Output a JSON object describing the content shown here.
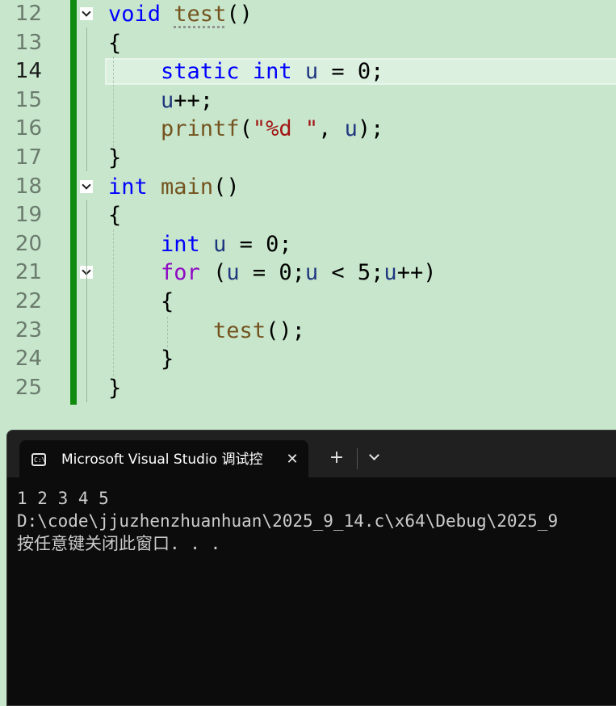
{
  "editor": {
    "lines": [
      {
        "num": "12",
        "tokens": [
          {
            "t": "void",
            "c": "kw"
          },
          {
            "t": " "
          },
          {
            "t": "test",
            "c": "fn squiggle"
          },
          {
            "t": "()"
          }
        ]
      },
      {
        "num": "13",
        "tokens": [
          {
            "t": "{"
          }
        ]
      },
      {
        "num": "14",
        "tokens": [
          {
            "t": "    "
          },
          {
            "t": "static",
            "c": "kw"
          },
          {
            "t": " "
          },
          {
            "t": "int",
            "c": "kw"
          },
          {
            "t": " "
          },
          {
            "t": "u",
            "c": "var"
          },
          {
            "t": " = 0;"
          }
        ]
      },
      {
        "num": "15",
        "tokens": [
          {
            "t": "    "
          },
          {
            "t": "u",
            "c": "var"
          },
          {
            "t": "++;"
          }
        ]
      },
      {
        "num": "16",
        "tokens": [
          {
            "t": "    "
          },
          {
            "t": "printf",
            "c": "fn"
          },
          {
            "t": "("
          },
          {
            "t": "\"%d \"",
            "c": "str"
          },
          {
            "t": ", "
          },
          {
            "t": "u",
            "c": "var"
          },
          {
            "t": ");"
          }
        ]
      },
      {
        "num": "17",
        "tokens": [
          {
            "t": "}"
          }
        ]
      },
      {
        "num": "18",
        "tokens": [
          {
            "t": "int",
            "c": "kw"
          },
          {
            "t": " "
          },
          {
            "t": "main",
            "c": "fn"
          },
          {
            "t": "()"
          }
        ]
      },
      {
        "num": "19",
        "tokens": [
          {
            "t": "{"
          }
        ]
      },
      {
        "num": "20",
        "tokens": [
          {
            "t": "    "
          },
          {
            "t": "int",
            "c": "kw"
          },
          {
            "t": " "
          },
          {
            "t": "u",
            "c": "var"
          },
          {
            "t": " = 0;"
          }
        ]
      },
      {
        "num": "21",
        "tokens": [
          {
            "t": "    "
          },
          {
            "t": "for",
            "c": "kw2"
          },
          {
            "t": " ("
          },
          {
            "t": "u",
            "c": "var"
          },
          {
            "t": " = 0;"
          },
          {
            "t": "u",
            "c": "var"
          },
          {
            "t": " < 5;"
          },
          {
            "t": "u",
            "c": "var"
          },
          {
            "t": "++)"
          }
        ]
      },
      {
        "num": "22",
        "tokens": [
          {
            "t": "    {"
          }
        ]
      },
      {
        "num": "23",
        "tokens": [
          {
            "t": "        "
          },
          {
            "t": "test",
            "c": "fn"
          },
          {
            "t": "();"
          }
        ]
      },
      {
        "num": "24",
        "tokens": [
          {
            "t": "    }"
          }
        ]
      },
      {
        "num": "25",
        "tokens": [
          {
            "t": "}"
          }
        ]
      }
    ],
    "current_line": "14",
    "fold_lines": [
      "12",
      "18",
      "21"
    ]
  },
  "terminal": {
    "tab_title": "Microsoft Visual Studio 调试控",
    "tab_icon": "terminal-icon",
    "close_icon": "close-icon",
    "new_tab_label": "+",
    "dropdown_icon": "chevron-down-icon",
    "output": [
      "1 2 3 4 5",
      "D:\\code\\jjuzhenzhuanhuan\\2025_9_14.c\\x64\\Debug\\2025_9",
      "按任意键关闭此窗口. . ."
    ]
  },
  "colors": {
    "editor_bg": "#c7e6cb",
    "change_bar": "#108b10",
    "keyword": "#0000ff",
    "control_keyword": "#8f08c4",
    "function": "#74531f",
    "variable": "#1f377f",
    "string": "#a31515",
    "terminal_bg": "#0c0c0c"
  }
}
